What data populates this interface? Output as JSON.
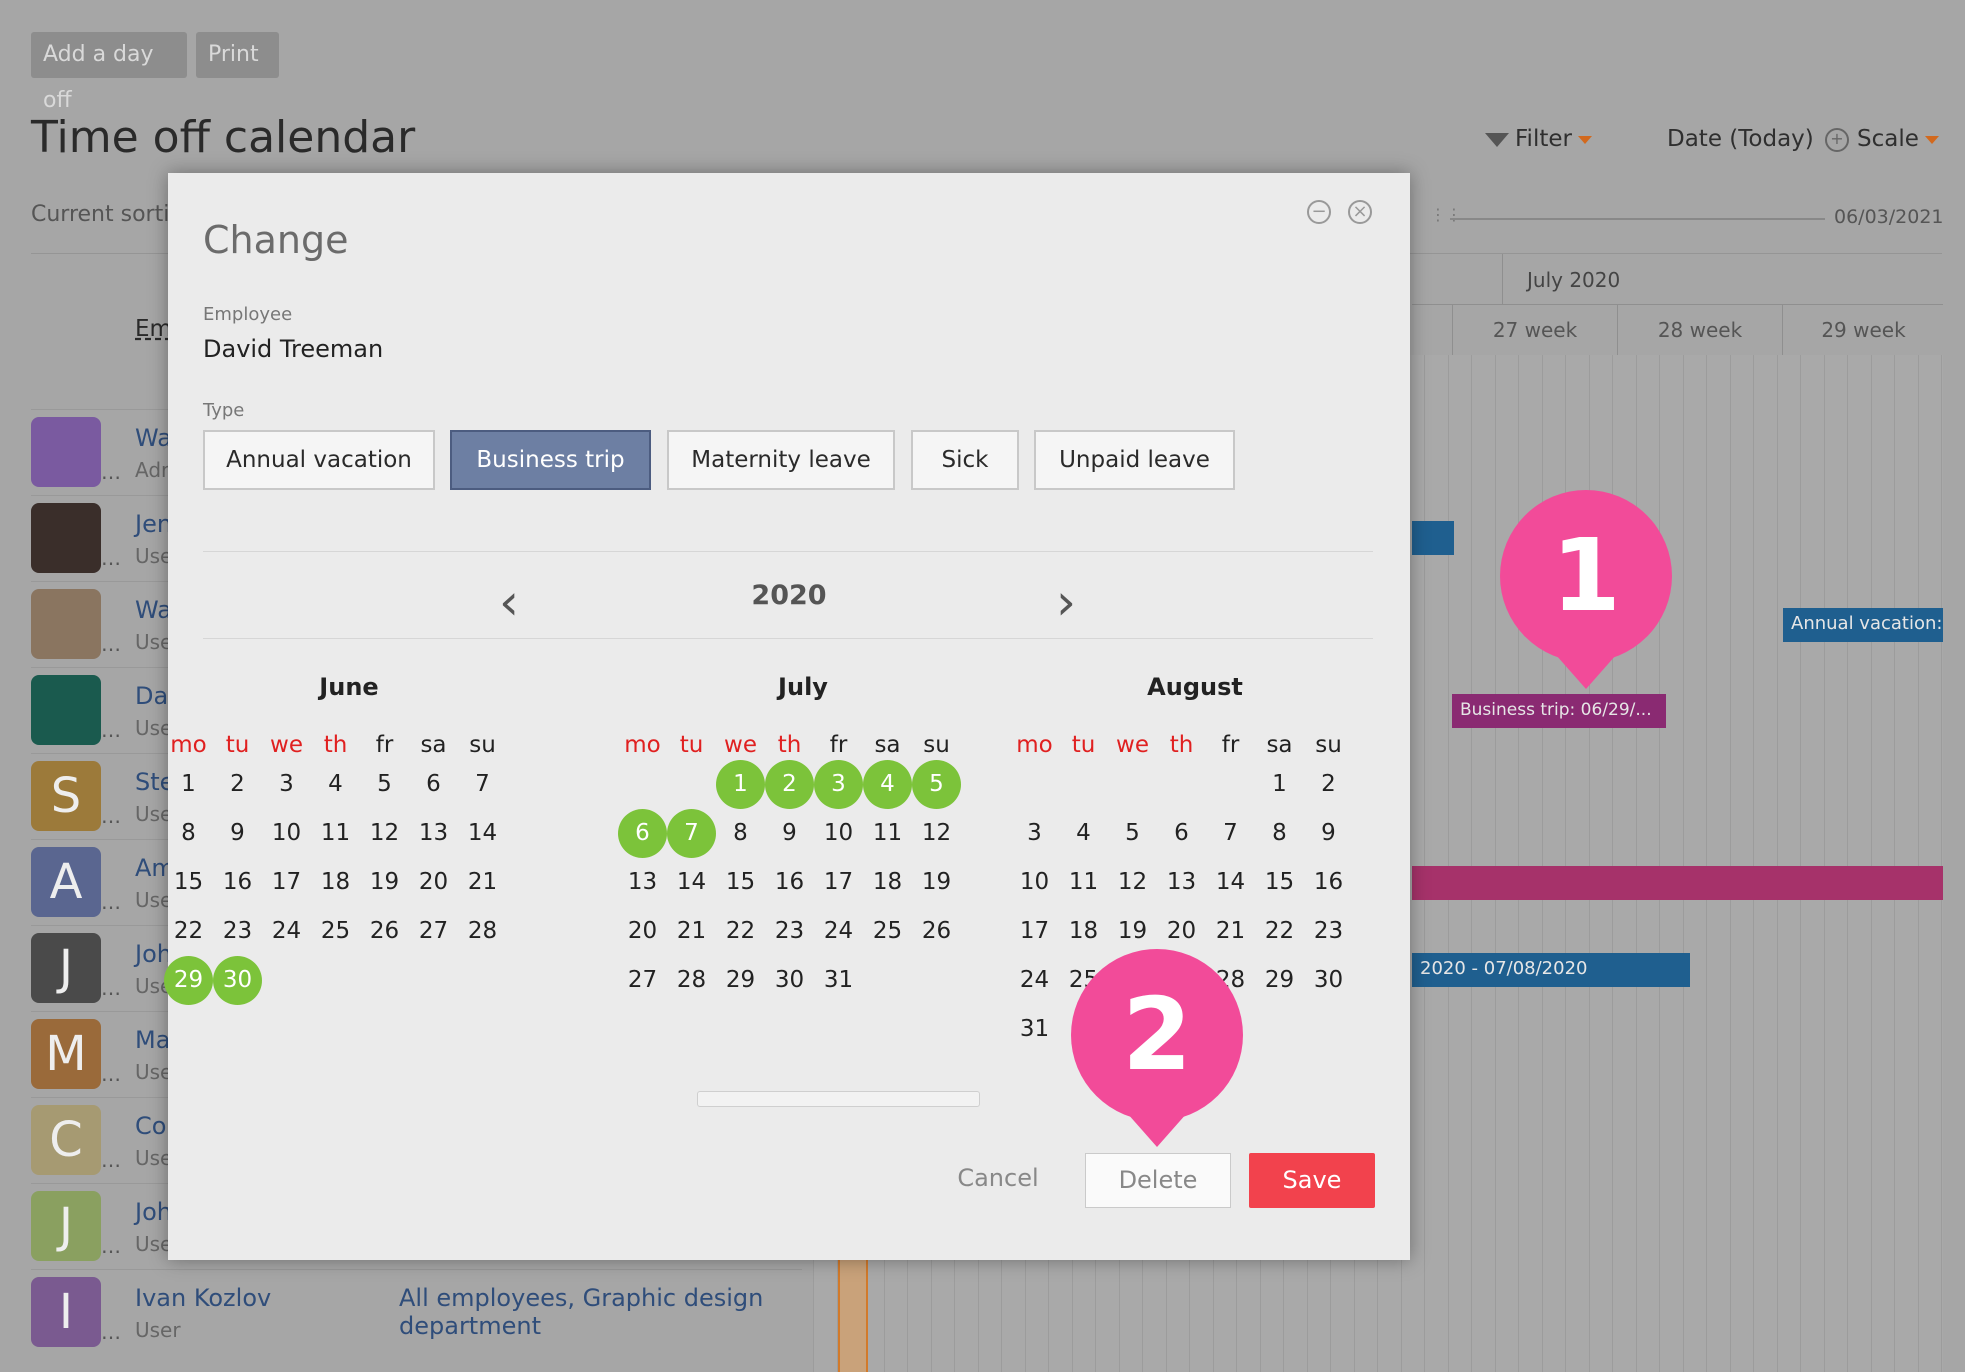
{
  "toolbar": {
    "add_day_off": "Add a day off",
    "print": "Print"
  },
  "page": {
    "title": "Time off calendar",
    "current_sorting": "Current sorti",
    "employee_header": "Em",
    "filter": "Filter",
    "date_today": "Date (Today)",
    "scale": "Scale",
    "slider_date": "06/03/2021"
  },
  "timeline": {
    "month": "July 2020",
    "weeks": [
      "27 week",
      "28 week",
      "29 week"
    ],
    "bars": {
      "business_trip": "Business trip: 06/29/...",
      "annual_vacation": "Annual vacation:",
      "range": "2020 - 07/08/2020"
    }
  },
  "employees": [
    {
      "name": "Wa",
      "role": "Adr",
      "initial": "",
      "color": "#7a5aa0"
    },
    {
      "name": "Jen",
      "role": "Use",
      "initial": "",
      "color": "#3a2e2a"
    },
    {
      "name": "Wa",
      "role": "Use",
      "initial": "",
      "color": "#8a7560"
    },
    {
      "name": "Da",
      "role": "Use",
      "initial": "",
      "color": "#1a5a4e"
    },
    {
      "name": "Ste",
      "role": "Use",
      "initial": "S",
      "color": "#9c7a3a"
    },
    {
      "name": "Am",
      "role": "Use",
      "initial": "A",
      "color": "#5a6690"
    },
    {
      "name": "Joh",
      "role": "Use",
      "initial": "J",
      "color": "#4a4a4a"
    },
    {
      "name": "Ma",
      "role": "Use",
      "initial": "M",
      "color": "#9a6a3a"
    },
    {
      "name": "Co",
      "role": "Use",
      "initial": "C",
      "color": "#a69a72"
    },
    {
      "name": "Joh",
      "role": "Use",
      "initial": "J",
      "color": "#8aa060"
    },
    {
      "name": "Ivan Kozlov",
      "role": "User",
      "initial": "I",
      "color": "#7a5a90",
      "groups_1": "All employees, Graphic design",
      "groups_2": "department"
    }
  ],
  "modal": {
    "title": "Change",
    "employee_label": "Employee",
    "employee_value": "David Treeman",
    "type_label": "Type",
    "types": [
      "Annual vacation",
      "Business trip",
      "Maternity leave",
      "Sick",
      "Unpaid leave"
    ],
    "selected_type": "Business trip",
    "year": "2020",
    "months": [
      {
        "name": "June"
      },
      {
        "name": "July"
      },
      {
        "name": "August"
      }
    ],
    "weekdays": [
      "mo",
      "tu",
      "we",
      "th",
      "fr",
      "sa",
      "su"
    ],
    "buttons": {
      "cancel": "Cancel",
      "delete": "Delete",
      "save": "Save"
    }
  },
  "markers": [
    "1",
    "2"
  ],
  "colors": {
    "selected_day": "#7cc33a",
    "save": "#f2424d",
    "active_type": "#6d7fa3",
    "marker": "#f24b99",
    "business_trip_bar": "#8a2a72",
    "vacation_bar": "#1f5f8f"
  }
}
